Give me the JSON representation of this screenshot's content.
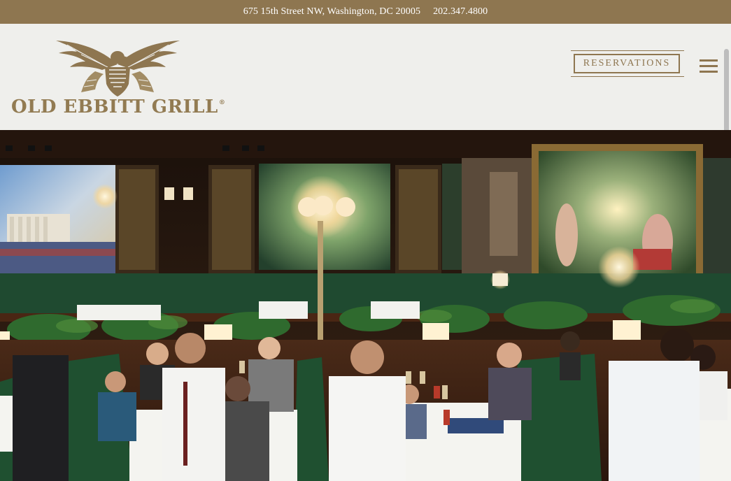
{
  "topbar": {
    "address": "675 15th Street NW, Washington, DC 20005",
    "phone": "202.347.4800"
  },
  "logo": {
    "name": "OLD EBBITT GRILL",
    "registered": "®",
    "icon": "eagle-emblem"
  },
  "header": {
    "reservations_label": "RESERVATIONS",
    "menu_icon": "hamburger-menu-icon"
  },
  "hero": {
    "subject": "restaurant-dining-room-photo"
  },
  "colors": {
    "brand_gold": "#8e7650",
    "header_bg": "#efefec",
    "logo_text": "#927b52"
  }
}
